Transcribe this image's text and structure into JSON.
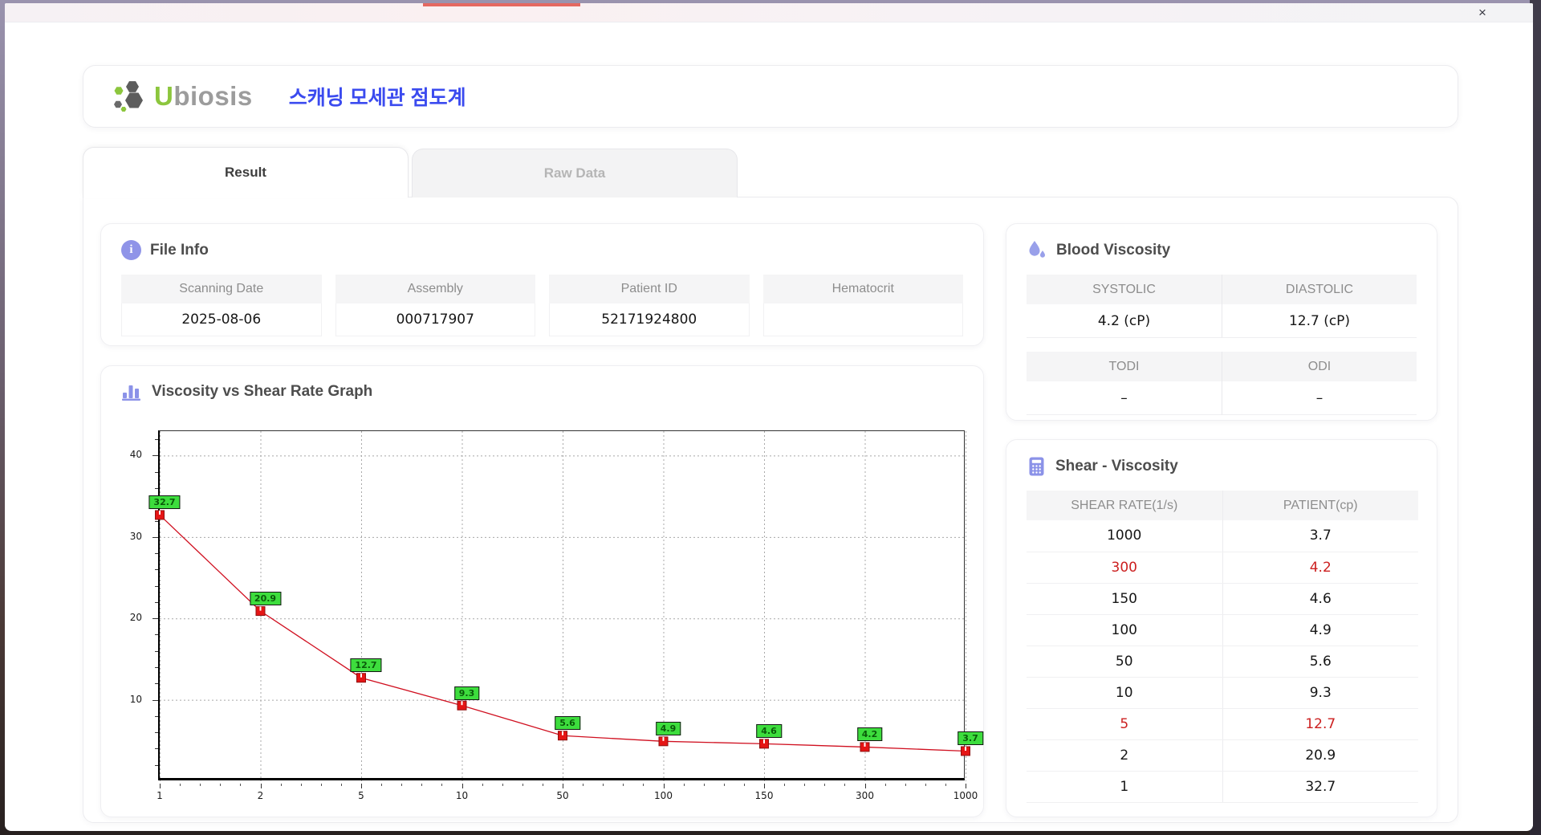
{
  "window": {
    "close_label": "×"
  },
  "header": {
    "logo_green": "U",
    "logo_gray": "biosis",
    "app_title": "스캐닝 모세관 점도계",
    "logo_colors": {
      "green": "#8cc63d",
      "gray": "#9c9c9c",
      "hex_dark": "#5d5d5d"
    },
    "accent_blue": "#3b4bef",
    "accent_purple": "#8f94e8"
  },
  "tabs": [
    {
      "label": "Result",
      "active": true
    },
    {
      "label": "Raw Data",
      "active": false
    }
  ],
  "file_info": {
    "title": "File Info",
    "fields": [
      {
        "label": "Scanning Date",
        "value": "2025-08-06"
      },
      {
        "label": "Assembly",
        "value": "000717907"
      },
      {
        "label": "Patient ID",
        "value": "52171924800"
      },
      {
        "label": "Hematocrit",
        "value": ""
      }
    ]
  },
  "blood_viscosity": {
    "title": "Blood Viscosity",
    "groups": [
      {
        "cells": [
          {
            "label": "SYSTOLIC",
            "value": "4.2 (cP)"
          },
          {
            "label": "DIASTOLIC",
            "value": "12.7 (cP)"
          }
        ]
      },
      {
        "cells": [
          {
            "label": "TODI",
            "value": "–"
          },
          {
            "label": "ODI",
            "value": "–"
          }
        ]
      }
    ]
  },
  "shear_viscosity": {
    "title": "Shear - Viscosity",
    "columns": [
      "SHEAR RATE(1/s)",
      "PATIENT(cp)"
    ],
    "rows": [
      {
        "shear": "1000",
        "patient": "3.7",
        "highlight": false
      },
      {
        "shear": "300",
        "patient": "4.2",
        "highlight": true
      },
      {
        "shear": "150",
        "patient": "4.6",
        "highlight": false
      },
      {
        "shear": "100",
        "patient": "4.9",
        "highlight": false
      },
      {
        "shear": "50",
        "patient": "5.6",
        "highlight": false
      },
      {
        "shear": "10",
        "patient": "9.3",
        "highlight": false
      },
      {
        "shear": "5",
        "patient": "12.7",
        "highlight": true
      },
      {
        "shear": "2",
        "patient": "20.9",
        "highlight": false
      },
      {
        "shear": "1",
        "patient": "32.7",
        "highlight": false
      }
    ],
    "highlight_color": "#cc2020"
  },
  "chart_data": {
    "type": "line",
    "title": "Viscosity vs Shear Rate Graph",
    "xlabel": "",
    "ylabel": "",
    "x_categories": [
      "1",
      "2",
      "5",
      "10",
      "50",
      "100",
      "150",
      "300",
      "1000"
    ],
    "series": [
      {
        "name": "PATIENT(cp)",
        "values": [
          32.7,
          20.9,
          12.7,
          9.3,
          5.6,
          4.9,
          4.6,
          4.2,
          3.7
        ]
      }
    ],
    "point_labels": [
      "32.7",
      "20.9",
      "12.7",
      "9.3",
      "5.6",
      "4.9",
      "4.6",
      "4.2",
      "3.7"
    ],
    "ylim": [
      0,
      43
    ],
    "yticks": [
      10,
      20,
      30,
      40
    ],
    "grid": true,
    "legend": "none",
    "line_color": "#d01020",
    "marker_color": "#e51515",
    "label_bg": "#3ddd3d"
  }
}
